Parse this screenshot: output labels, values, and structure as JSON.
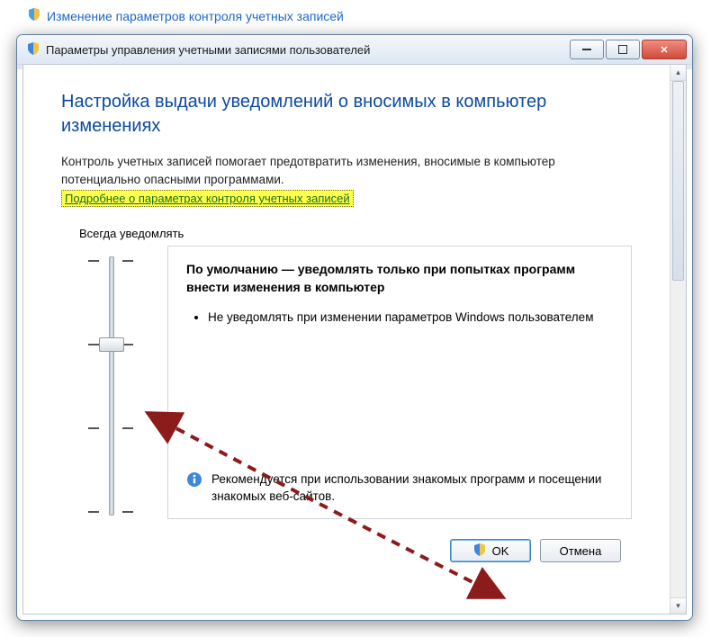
{
  "page_link": "Изменение параметров контроля учетных записей",
  "window": {
    "title": "Параметры управления учетными записями пользователей"
  },
  "heading": "Настройка выдачи уведомлений о вносимых в компьютер изменениях",
  "intro": "Контроль учетных записей помогает предотвратить изменения, вносимые в компьютер потенциально опасными программами.",
  "more_link": "Подробнее о параметрах контроля учетных записей",
  "slider": {
    "top_label": "Всегда уведомлять",
    "levels": 4,
    "current_level_index": 1
  },
  "description": {
    "title": "По умолчанию — уведомлять только при попытках программ внести изменения в компьютер",
    "bullets": [
      "Не уведомлять при изменении параметров Windows пользователем"
    ],
    "recommendation": "Рекомендуется при использовании знакомых программ и посещении знакомых веб-сайтов."
  },
  "buttons": {
    "ok": "OK",
    "cancel": "Отмена"
  },
  "icons": {
    "shield": "shield-icon",
    "info": "info-icon"
  }
}
